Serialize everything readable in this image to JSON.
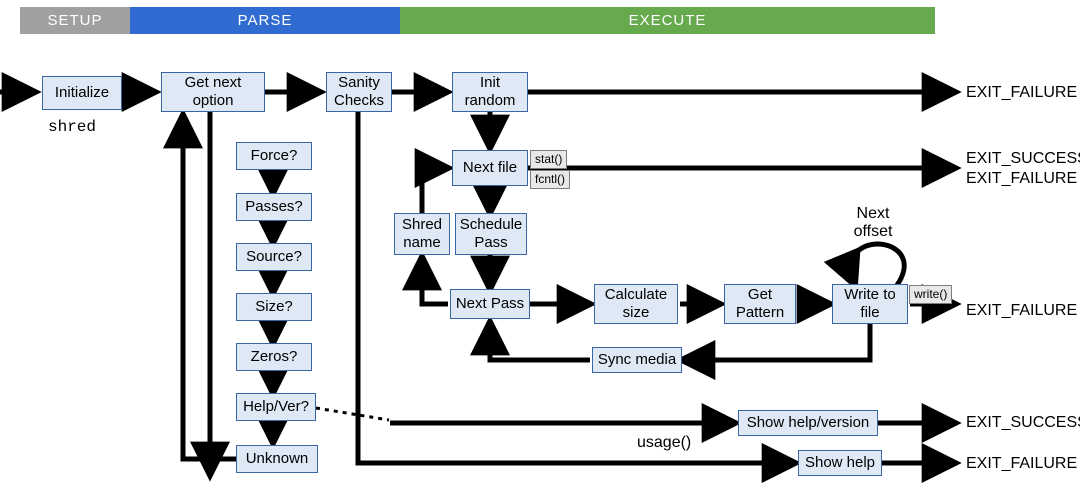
{
  "phases": {
    "setup": "SETUP",
    "parse": "PARSE",
    "execute": "EXECUTE"
  },
  "command": "shred",
  "nodes": {
    "initialize": "Initialize",
    "get_next_option": "Get next option",
    "sanity_checks": "Sanity Checks",
    "init_random": "Init random",
    "force": "Force?",
    "passes": "Passes?",
    "source": "Source?",
    "size": "Size?",
    "zeros": "Zeros?",
    "helpver": "Help/Ver?",
    "unknown": "Unknown",
    "next_file": "Next file",
    "shred_name": "Shred name",
    "schedule_pass": "Schedule Pass",
    "next_pass": "Next Pass",
    "calculate_size": "Calculate size",
    "get_pattern": "Get Pattern",
    "write_to_file": "Write to file",
    "sync_media": "Sync media",
    "show_help_version": "Show help/version",
    "show_help": "Show help"
  },
  "tags": {
    "stat": "stat()",
    "fcntl": "fcntl()",
    "write": "write()"
  },
  "labels": {
    "usage": "usage()",
    "next_offset": "Next offset"
  },
  "exits": {
    "ir": "EXIT_FAILURE",
    "nf_s": "EXIT_SUCCESS",
    "nf_f": "EXIT_FAILURE",
    "wf": "EXIT_FAILURE",
    "hv": "EXIT_SUCCESS",
    "uk": "EXIT_FAILURE"
  },
  "chart_data": {
    "type": "flowchart",
    "phases": [
      "SETUP",
      "PARSE",
      "EXECUTE"
    ],
    "nodes": [
      {
        "id": "initialize",
        "label": "Initialize",
        "phase": "SETUP"
      },
      {
        "id": "get_next_option",
        "label": "Get next option",
        "phase": "PARSE"
      },
      {
        "id": "sanity_checks",
        "label": "Sanity Checks",
        "phase": "PARSE"
      },
      {
        "id": "init_random",
        "label": "Init random",
        "phase": "EXECUTE"
      },
      {
        "id": "force",
        "label": "Force?",
        "phase": "PARSE"
      },
      {
        "id": "passes",
        "label": "Passes?",
        "phase": "PARSE"
      },
      {
        "id": "source",
        "label": "Source?",
        "phase": "PARSE"
      },
      {
        "id": "size",
        "label": "Size?",
        "phase": "PARSE"
      },
      {
        "id": "zeros",
        "label": "Zeros?",
        "phase": "PARSE"
      },
      {
        "id": "helpver",
        "label": "Help/Ver?",
        "phase": "PARSE"
      },
      {
        "id": "unknown",
        "label": "Unknown",
        "phase": "PARSE"
      },
      {
        "id": "next_file",
        "label": "Next file",
        "phase": "EXECUTE"
      },
      {
        "id": "shred_name",
        "label": "Shred name",
        "phase": "EXECUTE"
      },
      {
        "id": "schedule_pass",
        "label": "Schedule Pass",
        "phase": "EXECUTE"
      },
      {
        "id": "next_pass",
        "label": "Next Pass",
        "phase": "EXECUTE"
      },
      {
        "id": "calculate_size",
        "label": "Calculate size",
        "phase": "EXECUTE"
      },
      {
        "id": "get_pattern",
        "label": "Get Pattern",
        "phase": "EXECUTE"
      },
      {
        "id": "write_to_file",
        "label": "Write to file",
        "phase": "EXECUTE"
      },
      {
        "id": "sync_media",
        "label": "Sync media",
        "phase": "EXECUTE"
      },
      {
        "id": "show_help_version",
        "label": "Show help/version",
        "phase": "EXECUTE"
      },
      {
        "id": "show_help",
        "label": "Show help",
        "phase": "EXECUTE"
      }
    ],
    "edges": [
      {
        "from": "_entry",
        "to": "initialize"
      },
      {
        "from": "initialize",
        "to": "get_next_option"
      },
      {
        "from": "get_next_option",
        "to": "sanity_checks"
      },
      {
        "from": "sanity_checks",
        "to": "init_random"
      },
      {
        "from": "init_random",
        "to": "EXIT_FAILURE"
      },
      {
        "from": "get_next_option",
        "to": "force"
      },
      {
        "from": "force",
        "to": "passes"
      },
      {
        "from": "passes",
        "to": "source"
      },
      {
        "from": "source",
        "to": "size"
      },
      {
        "from": "size",
        "to": "zeros"
      },
      {
        "from": "zeros",
        "to": "helpver"
      },
      {
        "from": "helpver",
        "to": "unknown"
      },
      {
        "from": "unknown",
        "to": "get_next_option"
      },
      {
        "from": "init_random",
        "to": "next_file"
      },
      {
        "from": "next_file",
        "to": "EXIT_SUCCESS"
      },
      {
        "from": "next_file",
        "to": "EXIT_FAILURE"
      },
      {
        "from": "next_file",
        "to": "schedule_pass"
      },
      {
        "from": "schedule_pass",
        "to": "next_pass"
      },
      {
        "from": "next_pass",
        "to": "calculate_size"
      },
      {
        "from": "calculate_size",
        "to": "get_pattern"
      },
      {
        "from": "get_pattern",
        "to": "write_to_file"
      },
      {
        "from": "write_to_file",
        "to": "EXIT_FAILURE"
      },
      {
        "from": "write_to_file",
        "to": "write_to_file",
        "label": "Next offset"
      },
      {
        "from": "write_to_file",
        "to": "sync_media"
      },
      {
        "from": "sync_media",
        "to": "next_pass"
      },
      {
        "from": "next_pass",
        "to": "shred_name"
      },
      {
        "from": "shred_name",
        "to": "next_file"
      },
      {
        "from": "helpver",
        "to": "show_help_version",
        "style": "dashed",
        "label": "usage()"
      },
      {
        "from": "show_help_version",
        "to": "EXIT_SUCCESS"
      },
      {
        "from": "sanity_checks",
        "to": "show_help"
      },
      {
        "from": "show_help",
        "to": "EXIT_FAILURE"
      },
      {
        "from": "next_file",
        "calls": "stat()"
      },
      {
        "from": "next_file",
        "calls": "fcntl()"
      },
      {
        "from": "write_to_file",
        "calls": "write()"
      }
    ]
  }
}
